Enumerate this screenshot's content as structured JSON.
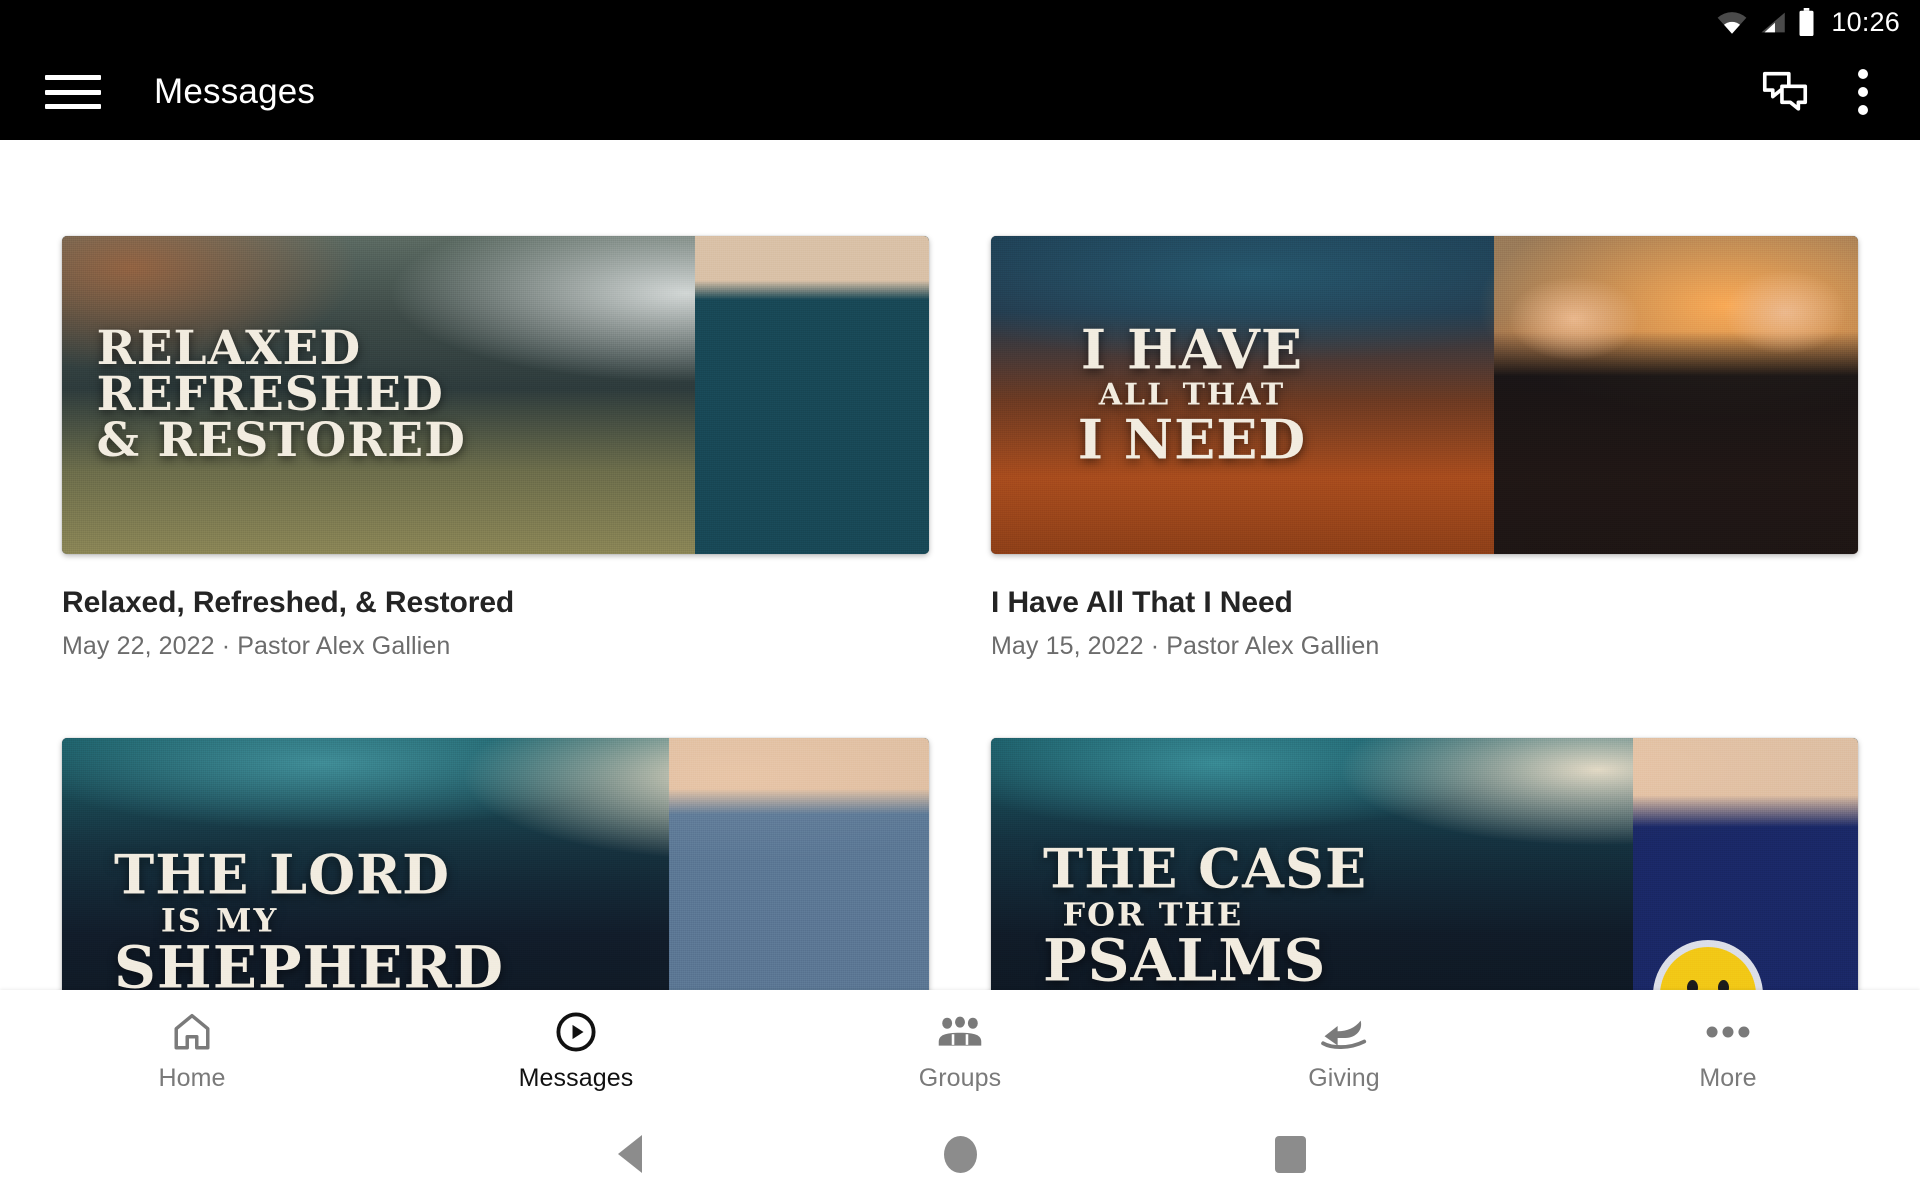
{
  "status_bar": {
    "time": "10:26",
    "icons": [
      "wifi-icon",
      "cell-signal-icon",
      "battery-icon"
    ]
  },
  "app_bar": {
    "menu_icon": "hamburger-menu-icon",
    "title": "Messages",
    "actions": [
      {
        "name": "chat-bubbles-icon"
      },
      {
        "name": "overflow-menu-icon"
      }
    ]
  },
  "messages": [
    {
      "title": "Relaxed, Refreshed, & Restored",
      "meta": "May 22, 2022 · Pastor Alex Gallien",
      "artwork_lines": [
        "RELAXED",
        "REFRESHED",
        "& RESTORED"
      ]
    },
    {
      "title": "I Have All That I Need",
      "meta": "May 15, 2022 · Pastor Alex Gallien",
      "artwork_lines": [
        "I HAVE",
        "ALL THAT",
        "I NEED"
      ]
    },
    {
      "title": "",
      "meta": "",
      "artwork_lines": [
        "THE LORD",
        "IS MY",
        "SHEPHERD"
      ]
    },
    {
      "title": "",
      "meta": "",
      "artwork_lines": [
        "THE CASE",
        "FOR THE",
        "PSALMS"
      ]
    }
  ],
  "bottom_nav": {
    "items": [
      {
        "label": "Home",
        "icon": "home-icon",
        "active": false
      },
      {
        "label": "Messages",
        "icon": "play-circle-icon",
        "active": true
      },
      {
        "label": "Groups",
        "icon": "people-group-icon",
        "active": false
      },
      {
        "label": "Giving",
        "icon": "giving-hand-heart-icon",
        "active": false
      },
      {
        "label": "More",
        "icon": "more-dots-icon",
        "active": false
      }
    ]
  },
  "system_nav": {
    "back": "back-triangle-icon",
    "home": "home-circle-icon",
    "recents": "recents-square-icon"
  },
  "colors": {
    "app_bar_bg": "#000000",
    "page_bg": "#ffffff",
    "title_text": "#242424",
    "meta_text": "#6c6c6c",
    "nav_inactive": "#7a7a7a",
    "nav_active": "#111111"
  }
}
